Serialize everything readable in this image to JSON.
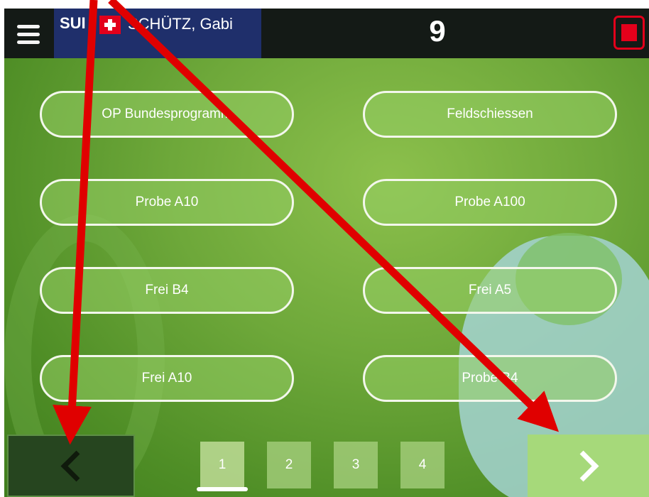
{
  "header": {
    "nation": "SUI",
    "athlete_name": "SCHÜTZ, Gabi",
    "shot_count": "9"
  },
  "programs": [
    {
      "label": "OP Bundesprogramm"
    },
    {
      "label": "Feldschiessen"
    },
    {
      "label": "Probe A10"
    },
    {
      "label": "Probe A100"
    },
    {
      "label": "Frei B4"
    },
    {
      "label": "Frei A5"
    },
    {
      "label": "Frei A10"
    },
    {
      "label": "Probe B4"
    }
  ],
  "pagination": {
    "pages": [
      "1",
      "2",
      "3",
      "4"
    ],
    "current": "1"
  },
  "icons": {
    "menu": "hamburger-menu-icon",
    "flag": "swiss-flag-icon",
    "stop": "stop-icon",
    "prev": "chevron-left-icon",
    "next": "chevron-right-icon"
  },
  "colors": {
    "header_bg": "#141a16",
    "athlete_bg": "#1f2f6b",
    "stop_red": "#e3001b",
    "annotation_arrow": "#e00000"
  }
}
